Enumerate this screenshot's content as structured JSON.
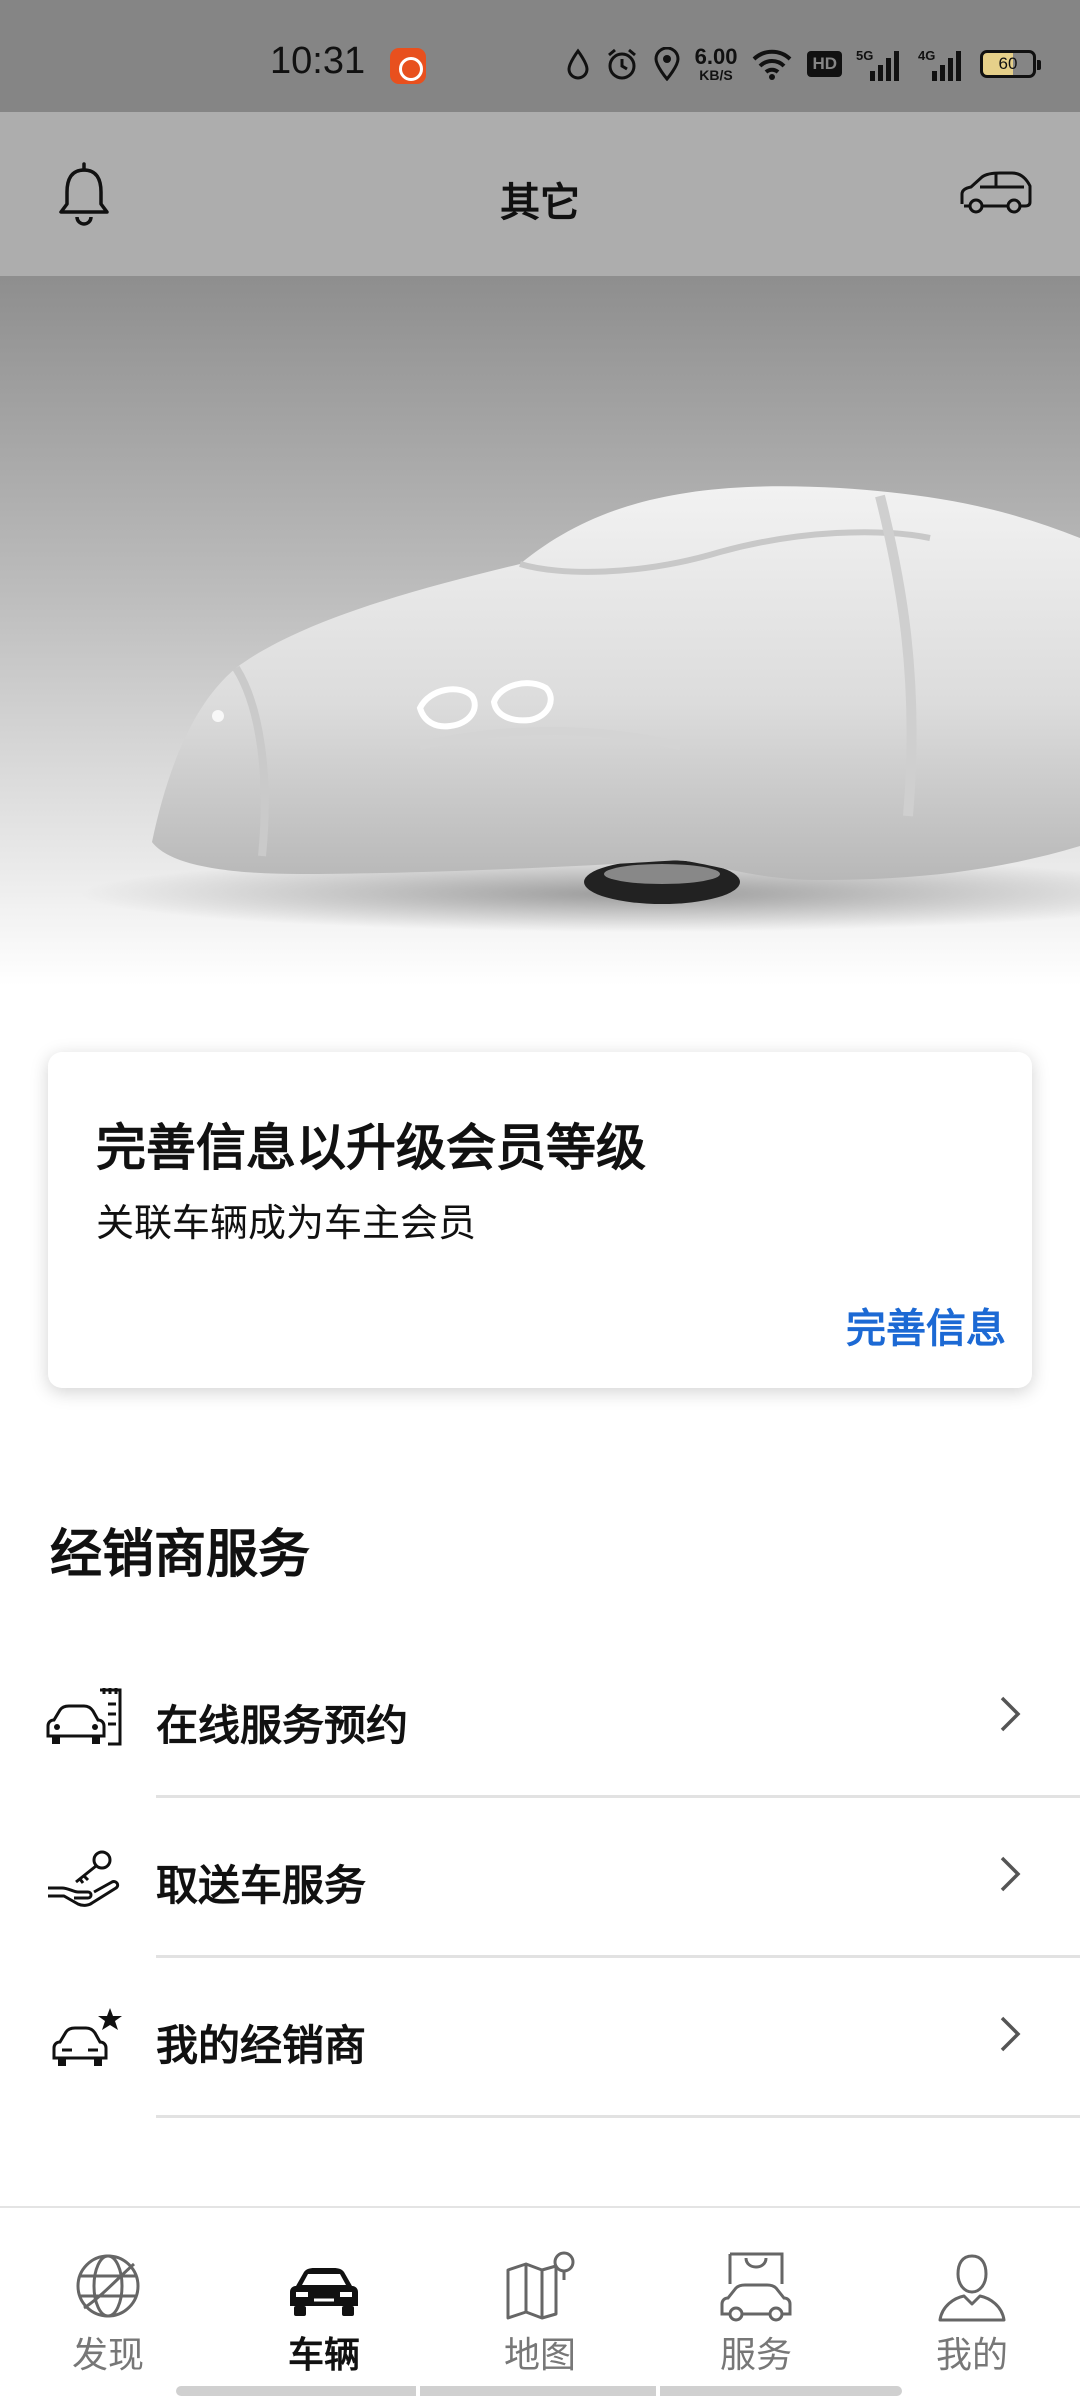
{
  "status_bar": {
    "time": "10:31",
    "net_speed_value": "6.00",
    "net_speed_unit": "KB/S",
    "hd_label": "HD",
    "signal_1": "5G",
    "signal_2": "4G",
    "battery": "60"
  },
  "header": {
    "title": "其它",
    "left_icon": "bell-icon",
    "right_icon": "car-switch-icon"
  },
  "member_card": {
    "title": "完善信息以升级会员等级",
    "subtitle": "关联车辆成为车主会员",
    "link_label": "完善信息",
    "link_color": "#1c69d4"
  },
  "dealer_services": {
    "title": "经销商服务",
    "items": [
      {
        "label": "在线服务预约",
        "icon": "service-booking-icon"
      },
      {
        "label": "取送车服务",
        "icon": "pickup-delivery-icon"
      },
      {
        "label": "我的经销商",
        "icon": "my-dealer-icon"
      }
    ]
  },
  "bottom_nav": {
    "items": [
      {
        "label": "发现",
        "icon": "globe-icon",
        "active": false
      },
      {
        "label": "车辆",
        "icon": "car-icon",
        "active": true
      },
      {
        "label": "地图",
        "icon": "map-icon",
        "active": false
      },
      {
        "label": "服务",
        "icon": "service-bag-icon",
        "active": false
      },
      {
        "label": "我的",
        "icon": "user-icon",
        "active": false
      }
    ]
  }
}
